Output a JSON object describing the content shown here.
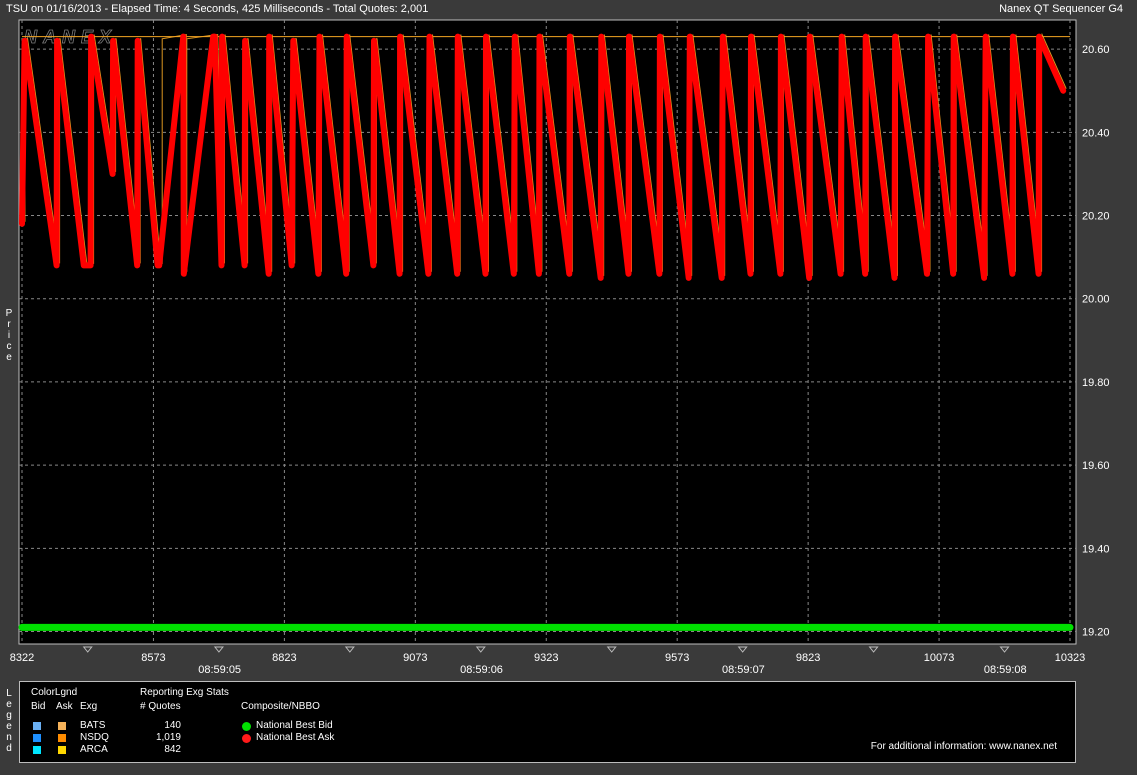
{
  "header": {
    "left": "TSU on 01/16/2013  -  Elapsed Time: 4 Seconds, 425 Milliseconds  -  Total Quotes: 2,001",
    "right": "Nanex QT Sequencer G4"
  },
  "watermark": "NANEX",
  "chart_data": {
    "type": "line",
    "ylabel": "Price",
    "ylim": [
      19.17,
      20.67
    ],
    "y_ticks": [
      "20.60",
      "20.40",
      "20.20",
      "20.00",
      "19.80",
      "19.60",
      "19.40",
      "19.20"
    ],
    "y_tick_values": [
      20.6,
      20.4,
      20.2,
      20.0,
      19.8,
      19.6,
      19.4,
      19.2
    ],
    "xlim": [
      8322,
      10323
    ],
    "x_ticks": [
      "8322",
      "8573",
      "8823",
      "9073",
      "9323",
      "9573",
      "9823",
      "10073",
      "10323"
    ],
    "x_tick_values": [
      8322,
      8573,
      8823,
      9073,
      9323,
      9573,
      9823,
      10073,
      10323
    ],
    "time_labels": [
      "08:59:05",
      "08:59:06",
      "08:59:07",
      "08:59:08"
    ],
    "time_label_x": [
      8823,
      9323,
      9823,
      10323
    ],
    "grid": true,
    "colors": {
      "bid": "#00e000",
      "ask": "#ff0000",
      "exchange_ask": "#f5a623",
      "grid": "#888888",
      "background": "#000000"
    },
    "series": [
      {
        "name": "National Best Bid",
        "x": [
          8322,
          10323
        ],
        "values": [
          19.21,
          19.21
        ]
      },
      {
        "name": "National Best Ask",
        "x": [
          8322,
          8327,
          8388,
          8389,
          8440,
          8453,
          8454,
          8495,
          8496,
          8542,
          8543,
          8581,
          8584,
          8630,
          8631,
          8687,
          8690,
          8703,
          8704,
          8747,
          8748,
          8793,
          8794,
          8837,
          8840,
          8888,
          8890,
          8941,
          8942,
          8993,
          8994,
          9043,
          9044,
          9098,
          9100,
          9153,
          9154,
          9207,
          9208,
          9261,
          9263,
          9309,
          9310,
          9367,
          9368,
          9427,
          9428,
          9480,
          9481,
          9539,
          9540,
          9595,
          9597,
          9658,
          9660,
          9713,
          9714,
          9770,
          9771,
          9825,
          9826,
          9885,
          9887,
          9932,
          9933,
          9988,
          9989,
          10050,
          10052,
          10100,
          10101,
          10159,
          10162,
          10213,
          10214,
          10263,
          10264,
          10310
        ],
        "values": [
          20.18,
          20.62,
          20.08,
          20.62,
          20.08,
          20.08,
          20.63,
          20.3,
          20.62,
          20.08,
          20.62,
          20.08,
          20.08,
          20.63,
          20.06,
          20.63,
          20.63,
          20.08,
          20.63,
          20.08,
          20.62,
          20.06,
          20.63,
          20.08,
          20.62,
          20.06,
          20.63,
          20.06,
          20.63,
          20.08,
          20.62,
          20.06,
          20.63,
          20.06,
          20.63,
          20.06,
          20.63,
          20.06,
          20.63,
          20.06,
          20.63,
          20.06,
          20.63,
          20.06,
          20.63,
          20.05,
          20.63,
          20.06,
          20.63,
          20.06,
          20.63,
          20.05,
          20.63,
          20.05,
          20.63,
          20.06,
          20.63,
          20.06,
          20.63,
          20.05,
          20.63,
          20.06,
          20.63,
          20.06,
          20.63,
          20.05,
          20.63,
          20.06,
          20.63,
          20.06,
          20.63,
          20.05,
          20.63,
          20.06,
          20.63,
          20.06,
          20.63,
          20.5
        ]
      }
    ]
  },
  "legend": {
    "side_label": "Legend",
    "color_legend_title": "ColorLgnd",
    "col_bid": "Bid",
    "col_ask": "Ask",
    "col_exg": "Exg",
    "stats_title": "Reporting Exg Stats",
    "quotes_header": "# Quotes",
    "composite_title": "Composite/NBBO",
    "exchanges": [
      {
        "name": "BATS",
        "quotes": "140",
        "bid_color": "#6ab0f3",
        "ask_color": "#f5b25a"
      },
      {
        "name": "NSDQ",
        "quotes": "1,019",
        "bid_color": "#1e90ff",
        "ask_color": "#ff8c00"
      },
      {
        "name": "ARCA",
        "quotes": "842",
        "bid_color": "#00e5ff",
        "ask_color": "#ffd700"
      }
    ],
    "nbbo": [
      {
        "label": "National Best Bid",
        "color": "#00e000"
      },
      {
        "label": "National Best Ask",
        "color": "#ff1a1a"
      }
    ],
    "footer": "For additional information: www.nanex.net"
  }
}
